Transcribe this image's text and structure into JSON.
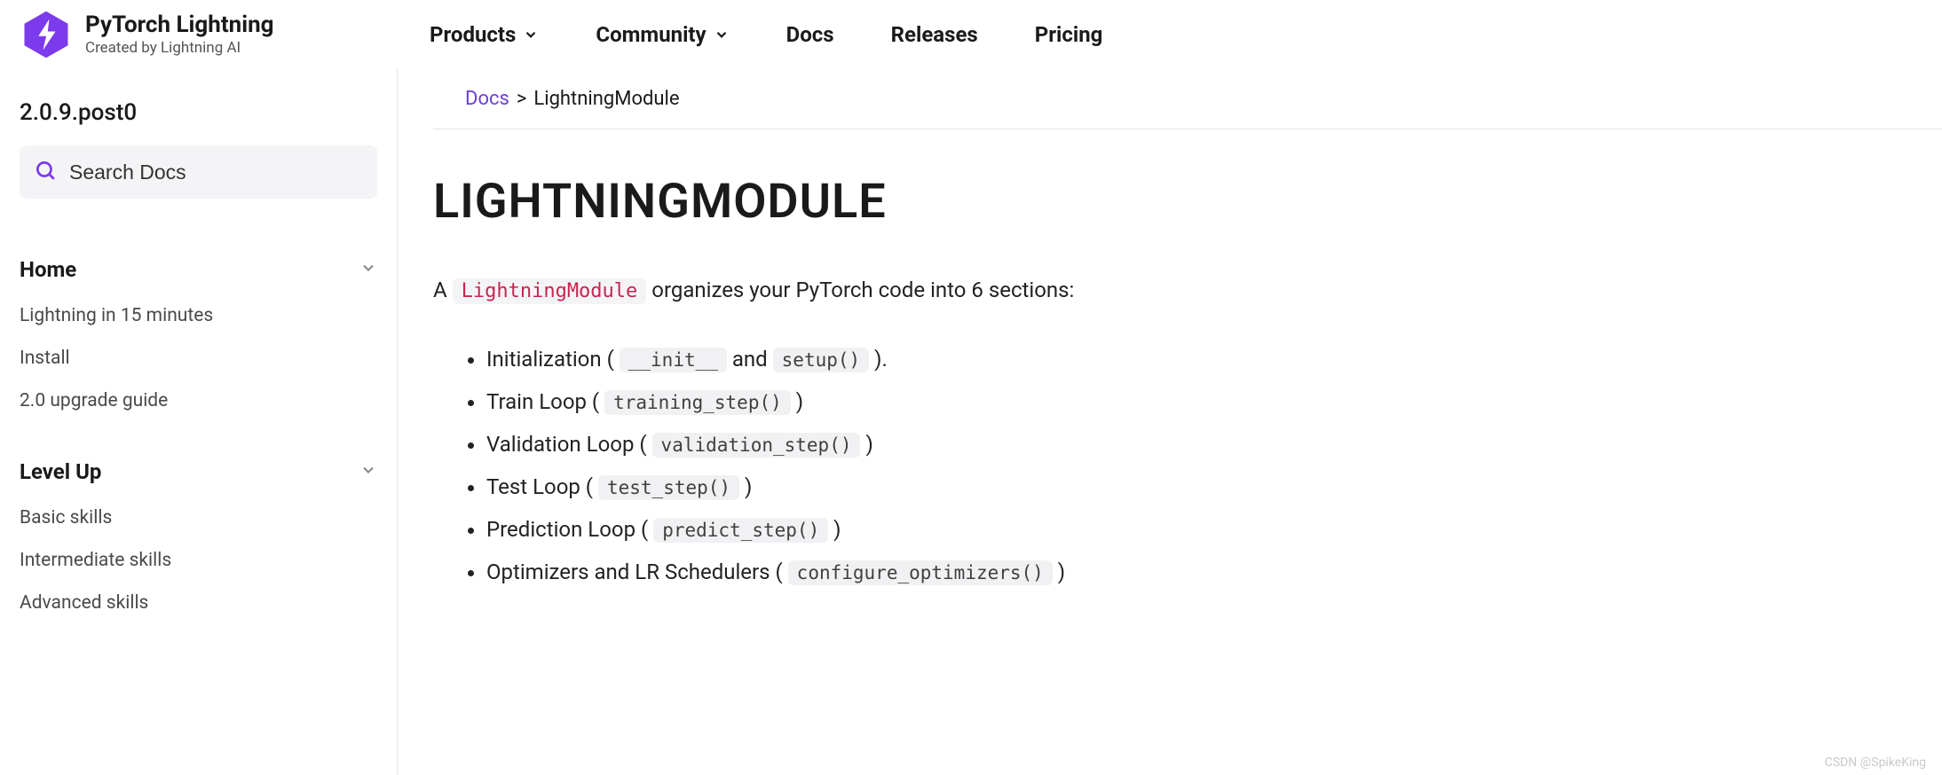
{
  "brand": {
    "title": "PyTorch Lightning",
    "subtitle": "Created by Lightning AI"
  },
  "topnav": {
    "products": "Products",
    "community": "Community",
    "docs": "Docs",
    "releases": "Releases",
    "pricing": "Pricing"
  },
  "sidebar": {
    "version": "2.0.9.post0",
    "search_placeholder": "Search Docs",
    "sections": [
      {
        "title": "Home",
        "items": [
          "Lightning in 15 minutes",
          "Install",
          "2.0 upgrade guide"
        ]
      },
      {
        "title": "Level Up",
        "items": [
          "Basic skills",
          "Intermediate skills",
          "Advanced skills"
        ]
      }
    ]
  },
  "breadcrumb": {
    "root": "Docs",
    "separator": ">",
    "current": "LightningModule"
  },
  "page": {
    "title": "LIGHTNINGMODULE",
    "intro_prefix": "A ",
    "intro_code": "LightningModule",
    "intro_suffix": " organizes your PyTorch code into 6 sections:"
  },
  "sections_list": [
    {
      "label": "Initialization",
      "codes": [
        "__init__",
        "setup()"
      ],
      "joiner": "and"
    },
    {
      "label": "Train Loop",
      "codes": [
        "training_step()"
      ]
    },
    {
      "label": "Validation Loop",
      "codes": [
        "validation_step()"
      ]
    },
    {
      "label": "Test Loop",
      "codes": [
        "test_step()"
      ]
    },
    {
      "label": "Prediction Loop",
      "codes": [
        "predict_step()"
      ]
    },
    {
      "label": "Optimizers and LR Schedulers",
      "codes": [
        "configure_optimizers()"
      ]
    }
  ],
  "watermark": "CSDN @SpikeKing"
}
